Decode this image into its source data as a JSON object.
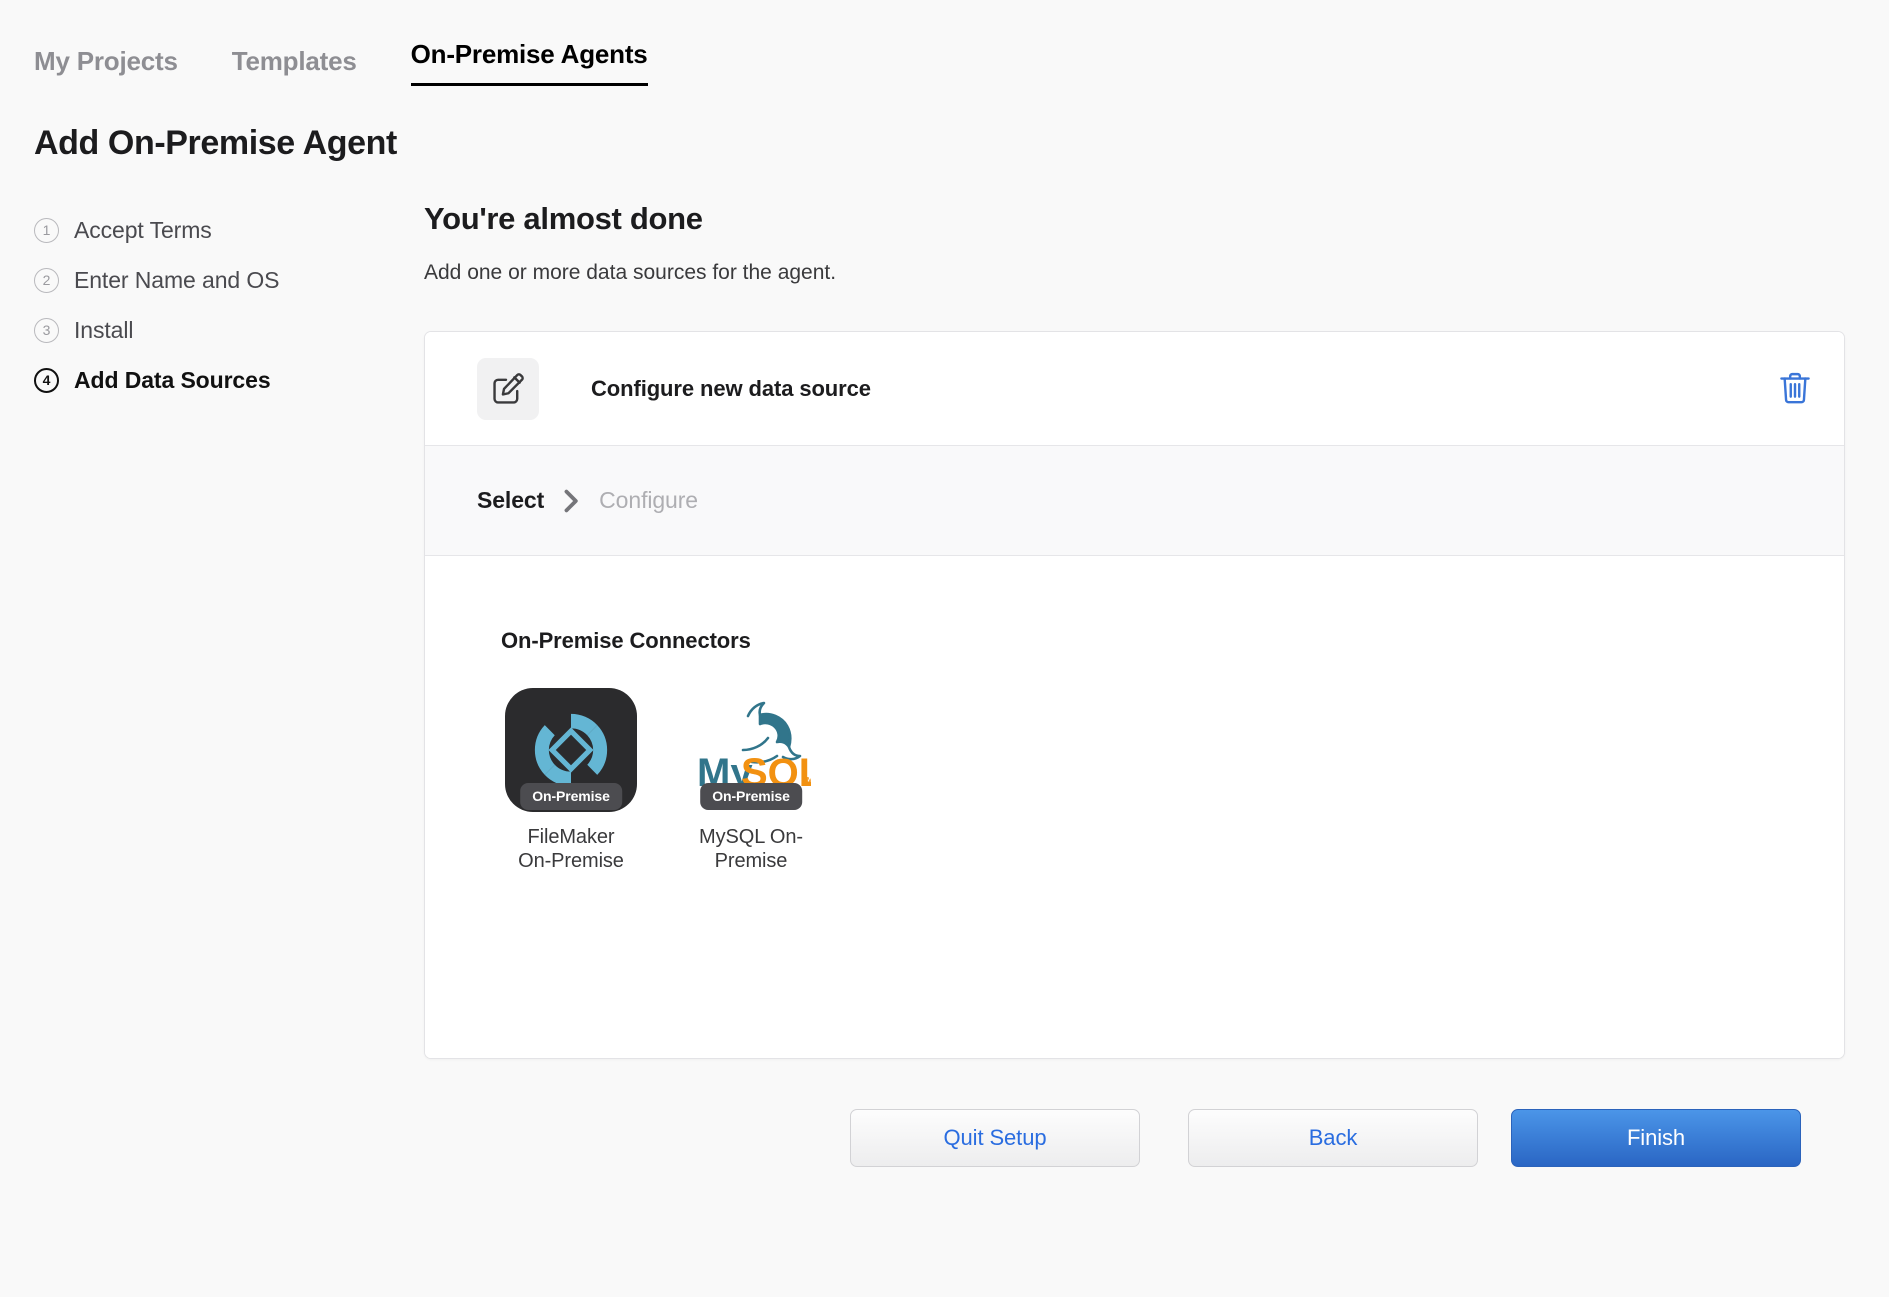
{
  "tabs": [
    {
      "label": "My Projects",
      "active": false
    },
    {
      "label": "Templates",
      "active": false
    },
    {
      "label": "On-Premise Agents",
      "active": true
    }
  ],
  "page": {
    "title": "Add On-Premise Agent"
  },
  "stepper": {
    "steps": [
      {
        "num": "1",
        "label": "Accept Terms",
        "current": false
      },
      {
        "num": "2",
        "label": "Enter Name and OS",
        "current": false
      },
      {
        "num": "3",
        "label": "Install",
        "current": false
      },
      {
        "num": "4",
        "label": "Add Data Sources",
        "current": true
      }
    ]
  },
  "main": {
    "heading": "You're almost done",
    "subheading": "Add one or more data sources for the agent."
  },
  "data_source_card": {
    "icon": "edit-square-icon",
    "title": "Configure new data source",
    "delete_icon": "trash-icon",
    "breadcrumb": [
      {
        "label": "Select",
        "state": "done"
      },
      {
        "label": "Configure",
        "state": "pending"
      }
    ],
    "separator_icon": "chevron-right-icon",
    "connectors_heading": "On-Premise Connectors",
    "connectors": [
      {
        "name": "FileMaker On-Premise",
        "label_line1": "FileMaker",
        "label_line2": "On-Premise",
        "badge": "On-Premise",
        "logo": "filemaker-logo",
        "tile_bg": "#2b2b2d",
        "logo_color": "#64b6d4"
      },
      {
        "name": "MySQL On-Premise",
        "label_line1": "MySQL On-",
        "label_line2": "Premise",
        "badge": "On-Premise",
        "logo": "mysql-logo",
        "tile_bg": "#ffffff",
        "logo_color_primary": "#31758b",
        "logo_color_secondary": "#f29111"
      }
    ]
  },
  "footer": {
    "quit": "Quit Setup",
    "back": "Back",
    "finish": "Finish"
  },
  "colors": {
    "page_bg": "#f9f9f9",
    "accent_blue": "#2a6de0",
    "finish_blue": "#3a7fd5",
    "badge_gray": "#4c4c50",
    "muted_text": "#8e8e93"
  }
}
